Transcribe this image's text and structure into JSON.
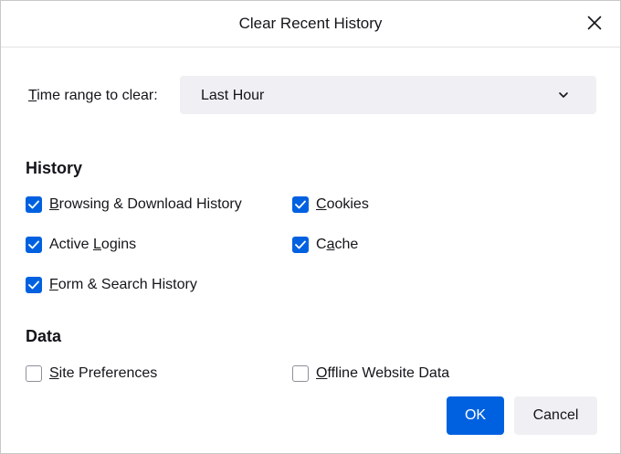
{
  "dialog": {
    "title": "Clear Recent History",
    "close_icon": "close-icon"
  },
  "time_range": {
    "label_prefix": "T",
    "label_rest": "ime range to clear:",
    "selected": "Last Hour",
    "chevron_icon": "chevron-down-icon"
  },
  "history": {
    "heading": "History",
    "items": [
      {
        "accel": "B",
        "rest": "rowsing & Download History",
        "checked": true
      },
      {
        "accel": "C",
        "rest": "ookies",
        "checked": true
      },
      {
        "pre": "Active ",
        "accel": "L",
        "rest": "ogins",
        "checked": true
      },
      {
        "pre": "C",
        "accel": "a",
        "rest": "che",
        "checked": true
      },
      {
        "accel": "F",
        "rest": "orm & Search History",
        "checked": true
      }
    ]
  },
  "data": {
    "heading": "Data",
    "items": [
      {
        "accel": "S",
        "rest": "ite Preferences",
        "checked": false
      },
      {
        "accel": "O",
        "rest": "ffline Website Data",
        "checked": false
      }
    ]
  },
  "buttons": {
    "ok": "OK",
    "cancel": "Cancel"
  },
  "colors": {
    "accent": "#0061e0",
    "button_secondary": "#f0f0f4"
  }
}
